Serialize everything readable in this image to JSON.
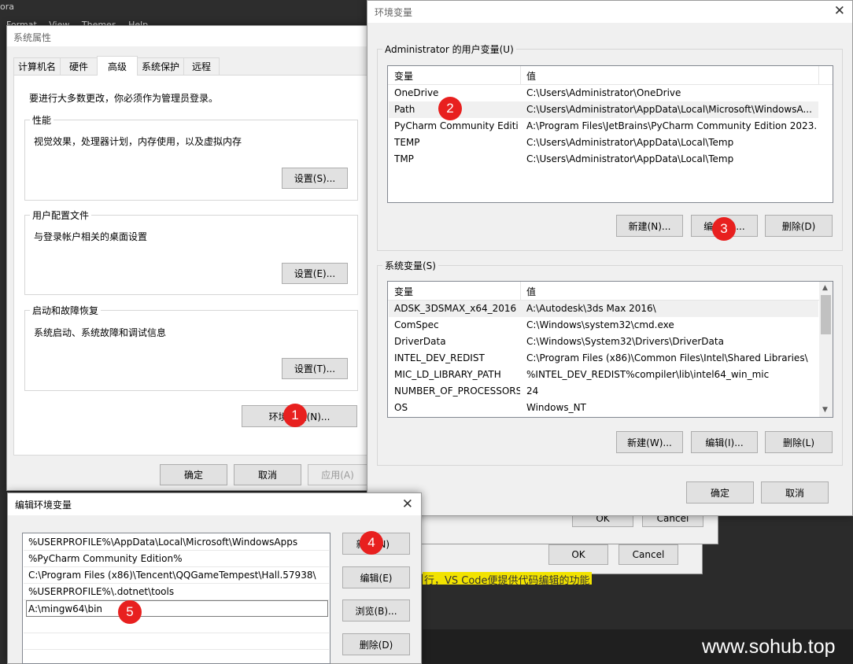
{
  "bg_editor": {
    "title_fragment": "ora",
    "menu": [
      "Format",
      "View",
      "Themes",
      "Help"
    ],
    "yellow_text": "行，VS Code便提供代码编辑的功能"
  },
  "back_dialogs": {
    "ok_label": "OK",
    "cancel_label": "Cancel"
  },
  "watermark": "www.sohub.top",
  "sysprops": {
    "title": "系统属性",
    "tabs": [
      "计算机名",
      "硬件",
      "高级",
      "系统保护",
      "远程"
    ],
    "active_tab": "高级",
    "admin_notice": "要进行大多数更改，你必须作为管理员登录。",
    "perf": {
      "label": "性能",
      "desc": "视觉效果，处理器计划，内存使用，以及虚拟内存",
      "button": "设置(S)..."
    },
    "profile": {
      "label": "用户配置文件",
      "desc": "与登录帐户相关的桌面设置",
      "button": "设置(E)..."
    },
    "startup": {
      "label": "启动和故障恢复",
      "desc": "系统启动、系统故障和调试信息",
      "button": "设置(T)..."
    },
    "env_button": "环境变量(N)...",
    "ok": "确定",
    "cancel": "取消",
    "apply": "应用(A)"
  },
  "envvars": {
    "title": "环境变量",
    "user_group": "Administrator 的用户变量(U)",
    "col_var": "变量",
    "col_val": "值",
    "user_rows": [
      {
        "name": "OneDrive",
        "value": "C:\\Users\\Administrator\\OneDrive"
      },
      {
        "name": "Path",
        "value": "C:\\Users\\Administrator\\AppData\\Local\\Microsoft\\WindowsA..."
      },
      {
        "name": "PyCharm Community Editi...",
        "value": "A:\\Program Files\\JetBrains\\PyCharm Community Edition 2023...."
      },
      {
        "name": "TEMP",
        "value": "C:\\Users\\Administrator\\AppData\\Local\\Temp"
      },
      {
        "name": "TMP",
        "value": "C:\\Users\\Administrator\\AppData\\Local\\Temp"
      }
    ],
    "user_buttons": {
      "new": "新建(N)...",
      "edit": "编辑(E)...",
      "delete": "删除(D)"
    },
    "sys_group": "系统变量(S)",
    "sys_rows": [
      {
        "name": "ADSK_3DSMAX_x64_2016",
        "value": "A:\\Autodesk\\3ds Max 2016\\"
      },
      {
        "name": "ComSpec",
        "value": "C:\\Windows\\system32\\cmd.exe"
      },
      {
        "name": "DriverData",
        "value": "C:\\Windows\\System32\\Drivers\\DriverData"
      },
      {
        "name": "INTEL_DEV_REDIST",
        "value": "C:\\Program Files (x86)\\Common Files\\Intel\\Shared Libraries\\"
      },
      {
        "name": "MIC_LD_LIBRARY_PATH",
        "value": "%INTEL_DEV_REDIST%compiler\\lib\\intel64_win_mic"
      },
      {
        "name": "NUMBER_OF_PROCESSORS",
        "value": "24"
      },
      {
        "name": "OS",
        "value": "Windows_NT"
      }
    ],
    "sys_buttons": {
      "new": "新建(W)...",
      "edit": "编辑(I)...",
      "delete": "删除(L)"
    },
    "ok": "确定",
    "cancel": "取消"
  },
  "editvar": {
    "title": "编辑环境变量",
    "items": [
      "%USERPROFILE%\\AppData\\Local\\Microsoft\\WindowsApps",
      "%PyCharm Community Edition%",
      "C:\\Program Files (x86)\\Tencent\\QQGameTempest\\Hall.57938\\",
      "%USERPROFILE%\\.dotnet\\tools",
      "A:\\mingw64\\bin"
    ],
    "new_button": "新建(N)",
    "edit_button": "编辑(E)",
    "browse_button": "浏览(B)...",
    "delete_button": "删除(D)"
  },
  "badges": [
    "1",
    "2",
    "3",
    "4",
    "5"
  ],
  "colors": {
    "badge": "#e8201f",
    "dialog_bg": "#f0f0f0",
    "focus_border": "#0078d7"
  }
}
